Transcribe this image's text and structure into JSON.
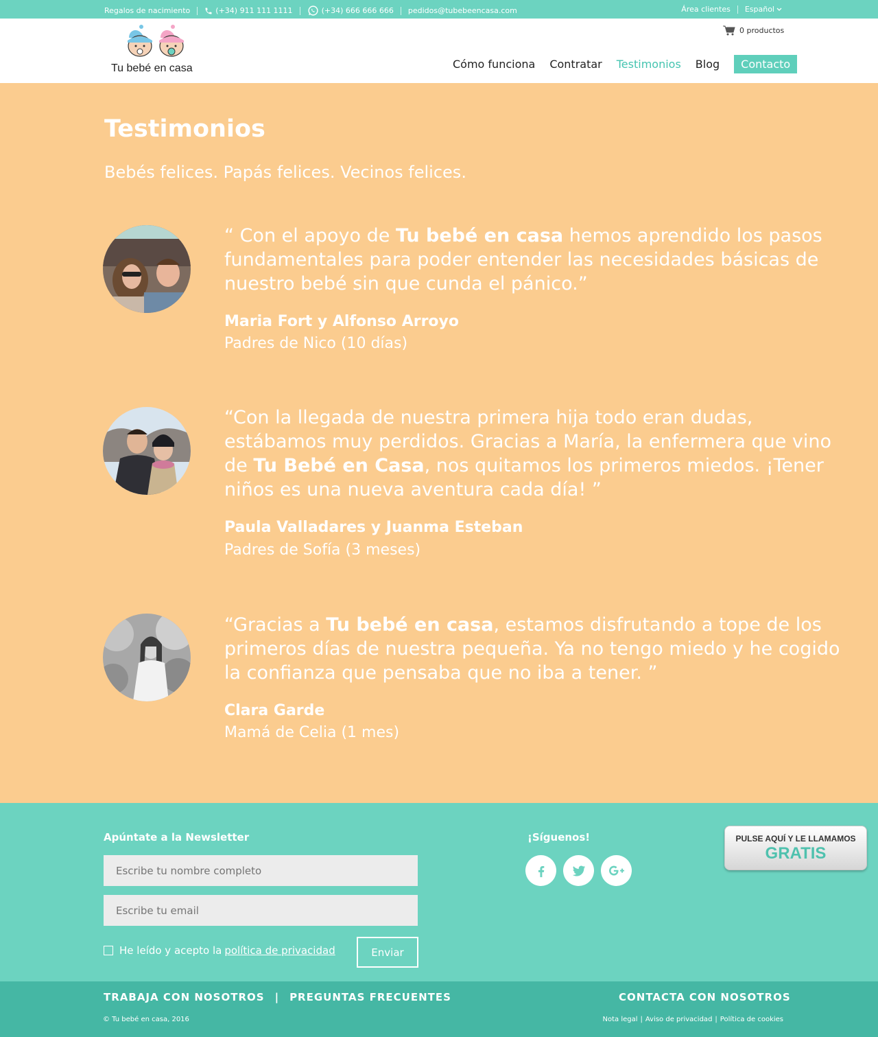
{
  "topbar": {
    "gifts": "Regalos de nacimiento",
    "phone": "(+34) 911 111 1111",
    "whatsapp": "(+34) 666 666 666",
    "email": "pedidos@tubebeencasa.com",
    "client_area": "Área clientes",
    "language": "Español"
  },
  "header": {
    "logo_text": "Tu bebé en casa",
    "cart": "0 productos",
    "nav": [
      "Cómo funciona",
      "Contratar",
      "Testimonios",
      "Blog"
    ],
    "contact": "Contacto"
  },
  "main": {
    "title": "Testimonios",
    "subtitle": "Bebés felices. Papás felices. Vecinos felices.",
    "testimonials": [
      {
        "q1": "“ Con el apoyo de ",
        "q2": "Tu bebé en casa",
        "q3": " hemos aprendido los pasos fundamentales para poder entender las necesidades básicas de nuestro bebé sin que cunda el pánico.”",
        "author": "Maria Fort y Alfonso Arroyo",
        "role": "Padres de Nico (10 días)"
      },
      {
        "q1": "“Con la llegada de nuestra primera hija todo eran dudas, estábamos muy perdidos. Gracias a María, la enfermera que vino de ",
        "q2": "Tu Bebé en Casa",
        "q3": ", nos quitamos los primeros miedos. ¡Tener niños es una nueva aventura cada día! ”",
        "author": "Paula Valladares y Juanma Esteban",
        "role": "Padres de Sofía (3 meses)"
      },
      {
        "q1": "“Gracias a ",
        "q2": "Tu bebé en casa",
        "q3": ", estamos disfrutando a tope de los primeros días de nuestra pequeña. Ya no tengo miedo y he cogido la confianza que pensaba que no iba a tener.  ”",
        "author": "Clara Garde",
        "role": "Mamá de Celia (1 mes)"
      }
    ]
  },
  "footer": {
    "newsletter_title": "Apúntate a la Newsletter",
    "name_placeholder": "Escribe tu nombre completo",
    "email_placeholder": "Escribe tu email",
    "consent_text": "He leído y acepto la",
    "consent_link": "política de privacidad",
    "send": "Enviar",
    "follow_title": "¡Síguenos!",
    "social_icons": [
      "facebook-icon",
      "twitter-icon",
      "google-plus-icon"
    ],
    "callme_line1": "PULSE AQUÍ Y LE LLAMAMOS",
    "callme_line2": "GRATIS"
  },
  "bottombar": {
    "work": "TRABAJA CON NOSOTROS",
    "divider": "|",
    "faq": "PREGUNTAS FRECUENTES",
    "contact": "CONTACTA CON NOSOTROS",
    "copyright": "© Tu bebé en casa, 2016",
    "legal": [
      "Nota legal",
      "Aviso de privacidad",
      "Política de cookies"
    ],
    "legal_sep": "|"
  },
  "colors": {
    "teal": "#6cd3c0",
    "teal_dark": "#45b7a4",
    "peach": "#fbcc8f",
    "accent": "#45c4b0"
  }
}
